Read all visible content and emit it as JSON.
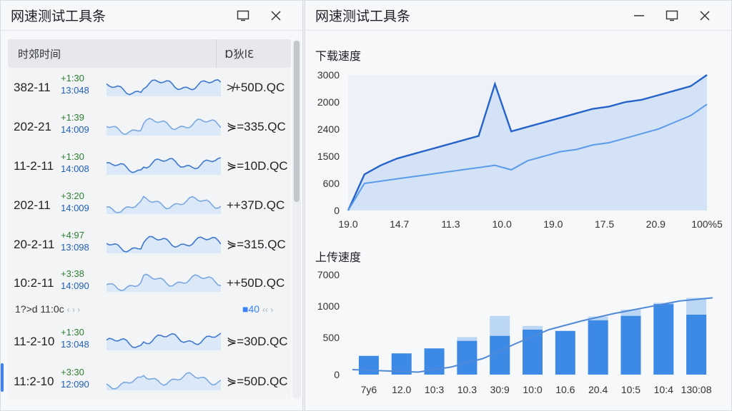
{
  "left_window": {
    "title": "网速测试工具条",
    "header": {
      "col_time": "时郊时间",
      "col_speed": "Ɒ狄lƐ"
    },
    "rows": [
      {
        "date": "382-11",
        "t1": "+1:30",
        "t2": "13:048",
        "speed": "≯+50D.QC"
      },
      {
        "date": "202-21",
        "t1": "+1:39",
        "t2": "14:009",
        "speed": "⋟=335.QC"
      },
      {
        "date": "11-2-11",
        "t1": "+1:30",
        "t2": "14:008",
        "speed": "⋟=10D.QC"
      },
      {
        "date": "202-11",
        "t1": "+3:20",
        "t2": "14:009",
        "speed": "++37D.QC"
      },
      {
        "date": "20-2-11",
        "t1": "+4:97",
        "t2": "13:098",
        "speed": "⋟=315.QC"
      },
      {
        "date": "10:2-11",
        "t1": "+3:38",
        "t2": "14:090",
        "speed": "++50D.QC"
      },
      {
        "date": "11-2-10",
        "t1": "+1:30",
        "t2": "13:048",
        "speed": "⋟=30D.QC"
      },
      {
        "date": "11:2-10",
        "t1": "+3:30",
        "t2": "12:090",
        "speed": "⋟=50D.QC"
      }
    ],
    "pager": {
      "left": "1?>d 11:0c",
      "left_arrows": "‹ › ›",
      "right": "■40",
      "right_arrows": "‹‹ ›"
    }
  },
  "right_window": {
    "title": "网速测试工具条"
  },
  "colors": {
    "accent": "#3b82f6",
    "line_dark": "#2563c9",
    "line_light": "#5b9be8",
    "area": "#c9dcf5",
    "bar": "#3d8ae6",
    "bar_light": "#bcd6f6"
  },
  "chart_data": [
    {
      "type": "line",
      "title": "下载速度",
      "x_tick_labels": [
        "19.0",
        "14.7",
        "11.3",
        "10.0",
        "19.0",
        "17.5",
        "20.9",
        "100%5"
      ],
      "y_tick_labels": [
        "3000",
        "2000",
        "2400",
        "1500",
        "600",
        "0"
      ],
      "ylim": [
        0,
        3000
      ],
      "series": [
        {
          "values": [
            0,
            800,
            1000,
            1150,
            1250,
            1350,
            1450,
            1550,
            1650,
            2800,
            1750,
            1850,
            1950,
            2050,
            2150,
            2250,
            2300,
            2400,
            2450,
            2550,
            2650,
            2750,
            3000
          ]
        },
        {
          "values": [
            0,
            600,
            650,
            700,
            750,
            800,
            850,
            900,
            950,
            1000,
            900,
            1100,
            1200,
            1300,
            1350,
            1450,
            1500,
            1600,
            1700,
            1800,
            1950,
            2100,
            2350
          ]
        }
      ],
      "grid": false
    },
    {
      "type": "bar",
      "title": "上传速度",
      "categories": [
        "7y6",
        "12.0",
        "10:3",
        "10.3",
        "30:9",
        "10:0",
        "10.6",
        "20.4",
        "10:5",
        "10:4",
        "130:08"
      ],
      "y_tick_labels": [
        "7000",
        "1000",
        "500",
        "0"
      ],
      "ylim": [
        0,
        1600
      ],
      "values": [
        300,
        340,
        420,
        540,
        620,
        720,
        700,
        870,
        940,
        1130,
        960
      ],
      "background_values": [
        0,
        0,
        0,
        600,
        940,
        780,
        0,
        930,
        1040,
        1150,
        1230
      ],
      "trend": [
        80,
        60,
        40,
        120,
        260,
        500,
        720,
        860,
        980,
        1080,
        1180,
        1230
      ]
    }
  ]
}
